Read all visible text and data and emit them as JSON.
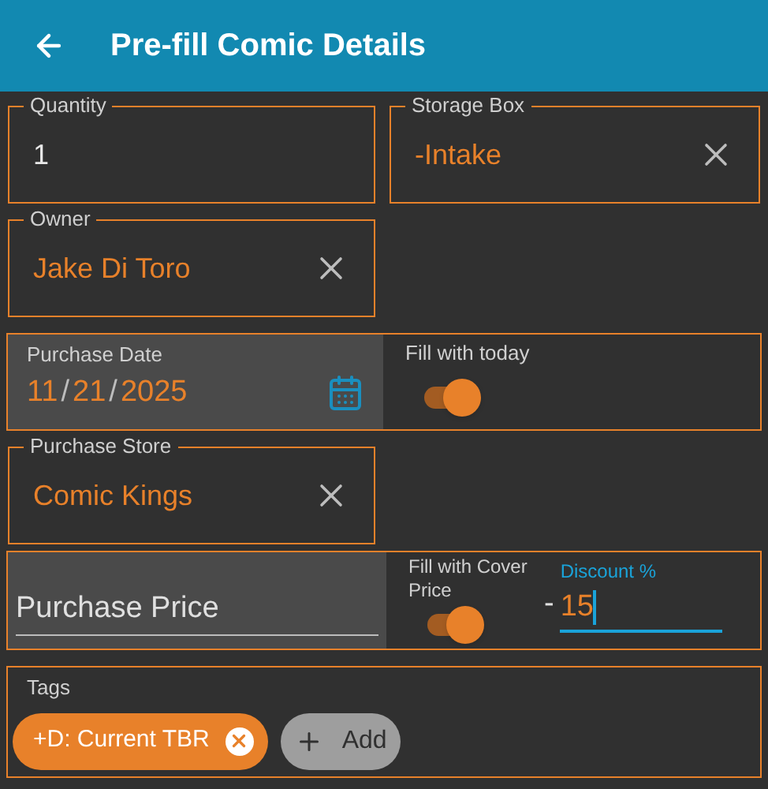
{
  "app_bar": {
    "title": "Pre-fill Comic Details"
  },
  "quantity": {
    "label": "Quantity",
    "value": "1"
  },
  "storage_box": {
    "label": "Storage Box",
    "value": "-Intake",
    "clearable": true
  },
  "owner": {
    "label": "Owner",
    "value": "Jake Di Toro",
    "clearable": true
  },
  "purchase_date": {
    "label": "Purchase Date",
    "parts": [
      "11",
      "21",
      "2025"
    ],
    "separators": [
      "/",
      "/"
    ],
    "toggle": {
      "label": "Fill with today",
      "on": true
    }
  },
  "purchase_store": {
    "label": "Purchase Store",
    "value": "Comic Kings",
    "clearable": true
  },
  "purchase_price": {
    "placeholder": "Purchase Price",
    "toggle": {
      "label": "Fill with Cover Price",
      "on": true
    },
    "sign": "-",
    "discount": {
      "label": "Discount %",
      "value": "15",
      "focused": true
    }
  },
  "tags": {
    "label": "Tags",
    "chips": [
      {
        "label": "+D: Current TBR"
      }
    ],
    "add_button": "Add"
  }
}
